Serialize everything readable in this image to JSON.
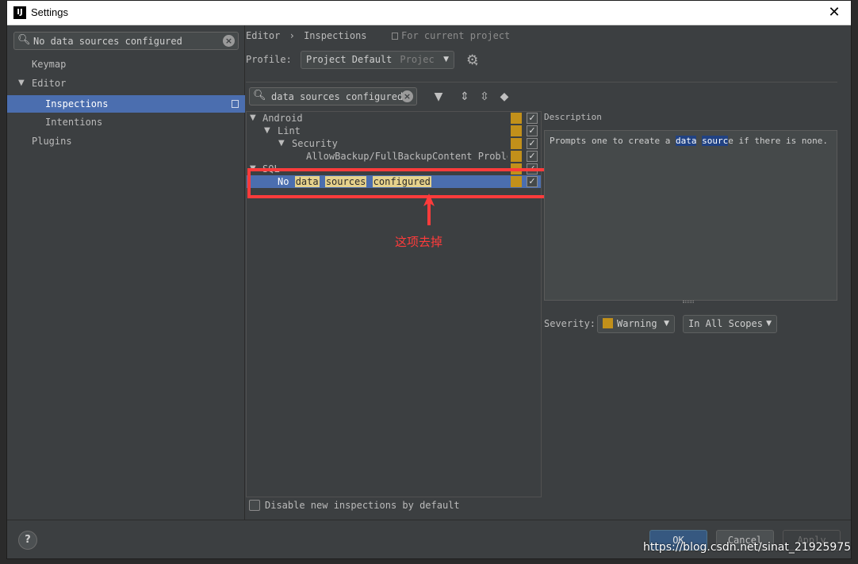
{
  "window": {
    "title": "Settings",
    "app_icon": "IJ"
  },
  "left_panel": {
    "search_value": "No data sources configured",
    "nav": [
      {
        "label": "Keymap"
      },
      {
        "label": "Editor"
      },
      {
        "label": "Inspections"
      },
      {
        "label": "Intentions"
      },
      {
        "label": "Plugins"
      }
    ]
  },
  "breadcrumb": {
    "root": "Editor",
    "separator": "›",
    "current": "Inspections",
    "scope_note": "For current project"
  },
  "profile": {
    "label": "Profile:",
    "value": "Project Default",
    "suffix": "Projec"
  },
  "filter": {
    "value": "data sources configured"
  },
  "tree": {
    "rows": [
      {
        "label": "Android"
      },
      {
        "label": "Lint"
      },
      {
        "label": "Security"
      },
      {
        "label": "AllowBackup/FullBackupContent Problem"
      },
      {
        "label": "SQL"
      },
      {
        "prefix": "No",
        "hl1": "data",
        "hl2": "sources",
        "hl3": "configured"
      }
    ],
    "disable_label": "Disable new inspections by default"
  },
  "annotation": {
    "text": "这项去掉"
  },
  "description": {
    "title": "Description",
    "t1": "Prompts one to create a ",
    "h1": "data",
    "h2": "sourc",
    "t2": "e if there is none."
  },
  "severity": {
    "label": "Severity:",
    "value": "Warning",
    "scope": "In All Scopes"
  },
  "footer": {
    "help": "?",
    "ok": "OK",
    "cancel": "Cancel",
    "apply": "Apply"
  },
  "watermark": "https://blog.csdn.net/sinat_21925975",
  "colors": {
    "selection": "#4b6eaf",
    "warning": "#c2901a",
    "annotation": "#ff3b3b",
    "ok_button": "#365880"
  }
}
